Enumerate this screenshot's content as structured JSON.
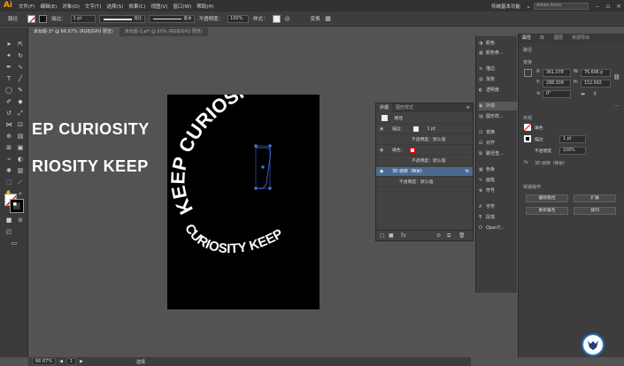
{
  "app": {
    "logo": "Ai",
    "workspace": "传统基本功能",
    "search_placeholder": "Adobe Stock"
  },
  "menu": [
    "文件(F)",
    "编辑(E)",
    "对象(O)",
    "文字(T)",
    "选择(S)",
    "效果(C)",
    "视图(V)",
    "窗口(W)",
    "帮助(H)"
  ],
  "control": {
    "path_label": "路径",
    "stroke_label": "描边：",
    "stroke_value": "1 pt",
    "uniform": "等比",
    "basic": "基本",
    "opacity_label": "不透明度：",
    "opacity_value": "100%",
    "style_label": "样式：",
    "transform": "变换"
  },
  "tabs": [
    "未标题-3* @ 66.67% (RGB/GPU 预览)",
    "未标题-1.ai* @ 50% (RGB/GPU 预览)"
  ],
  "canvas": {
    "line1": "EP CURIOSITY",
    "line2": "RIOSITY KEEP",
    "ring_top": "KEEP CURIOSITY",
    "ring_bottom": "CURIOSITY KEEP"
  },
  "status": {
    "zoom": "66.67%",
    "page": "1",
    "tool": "选择"
  },
  "appearance": {
    "tabs": [
      "外观",
      "图形样式"
    ],
    "rows": [
      "路径",
      "描边：",
      "1 pt",
      "不透明度：默认值",
      "填色：",
      "不透明度：默认值",
      "3D 绕转（映射）",
      "不透明度：默认值"
    ],
    "fx": "fx"
  },
  "iconcol": [
    "颜色",
    "颜色参...",
    "描边",
    "渐变",
    "透明度",
    "外观",
    "图形样...",
    "变换",
    "对齐",
    "路径查...",
    "色板",
    "画笔",
    "符号",
    "字符",
    "段落",
    "OpenT..."
  ],
  "props": {
    "tabs": [
      "属性",
      "库",
      "图层",
      "资源导出"
    ],
    "section_path": "路径",
    "section_transform": "变换",
    "x": "361.078",
    "y": "288.309",
    "w": "76.696 p",
    "h": "152.992",
    "angle": "0°",
    "section_appearance": "外观",
    "fill": "填色",
    "stroke": "描边",
    "stroke_val": "1 pt",
    "opacity": "不透明度",
    "opacity_val": "100%",
    "fx_label": "3D 绕转（映射）",
    "section_quick": "快速操作",
    "btn1": "偏移路径",
    "btn2": "扩展",
    "btn3": "重新着色",
    "btn4": "排列"
  },
  "colors": {
    "accent": "#4a6a90",
    "logo": "#ff9a00",
    "panel": "#424242"
  }
}
